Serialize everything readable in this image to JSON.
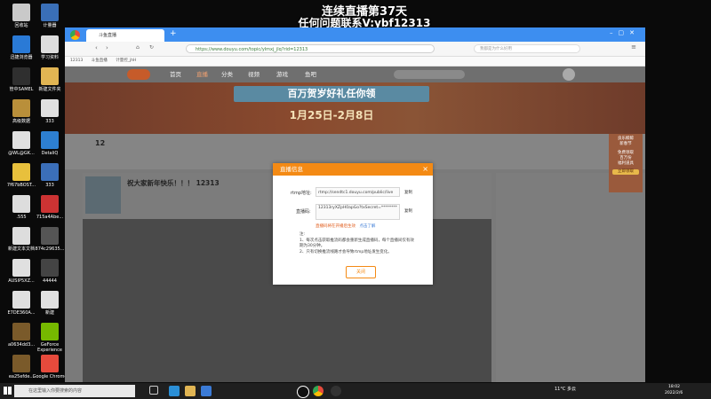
{
  "overlay": {
    "line1": "连续直播第37天",
    "line2": "任何问题联系V:ybf12313"
  },
  "desktop_icons": [
    {
      "label": "回收站",
      "color": "#c9c9c9"
    },
    {
      "label": "计量器",
      "color": "#3a6fb7"
    },
    {
      "label": "迅捷浏览器",
      "color": "#2a7ad6"
    },
    {
      "label": "学习资料",
      "color": "#dddddd"
    },
    {
      "label": "管中SAMEL",
      "color": "#2f2f2f"
    },
    {
      "label": "新建文件夹",
      "color": "#e1b553"
    },
    {
      "label": "高级数据",
      "color": "#b98f3a"
    },
    {
      "label": "333",
      "color": "#e0e0e0"
    },
    {
      "label": "@WL@GK...",
      "color": "#e0e0e0"
    },
    {
      "label": "DetaliQ",
      "color": "#2d7fd1"
    },
    {
      "label": "7f67bBOST...",
      "color": "#e8c03c"
    },
    {
      "label": "333",
      "color": "#3b6fb9"
    },
    {
      "label": ".555",
      "color": "#dddddd"
    },
    {
      "label": "715a4Abe...",
      "color": "#c33"
    },
    {
      "label": "新建文本文档",
      "color": "#dddddd"
    },
    {
      "label": "874c29635...",
      "color": "#555"
    },
    {
      "label": "AUSIP5XZ...",
      "color": "#e0e0e0"
    },
    {
      "label": "44444",
      "color": "#444"
    },
    {
      "label": "E7DE360A...",
      "color": "#e0e0e0"
    },
    {
      "label": "新建",
      "color": "#e0e0e0"
    },
    {
      "label": "a0634dd3...",
      "color": "#7a5a2a"
    },
    {
      "label": "GeForce Experience",
      "color": "#76b900"
    },
    {
      "label": "ea25efde...",
      "color": "#7a5a2a"
    },
    {
      "label": "Google Chrome",
      "color": "#e64a3c"
    }
  ],
  "browser": {
    "tab_title": "斗鱼直播",
    "url": "https://www.douyu.com/topic/ylmxj_jlq?rid=12313",
    "bookmarks": [
      "12313",
      "斗鱼直播",
      "计量控_jhH"
    ],
    "search_placeholder": "我都是为什么好用"
  },
  "site": {
    "nav": [
      "首页",
      "直播",
      "分类",
      "视频",
      "游戏",
      "鱼吧"
    ],
    "banner_title": "百万贺岁好礼任你领",
    "banner_date": "1月25日-2月8日",
    "room_title": "祝大家新年快乐！！！ 12313",
    "room_count": "12",
    "banner_right_top": "良乐鲸鲸\n新春节",
    "banner_right_gift": "免费领取\n百万份\n福利道具",
    "banner_right_btn": "立即领取"
  },
  "modal": {
    "title": "直播信息",
    "close": "×",
    "rtmp_label": "rtmp地址:",
    "rtmp_value": "rtmp://sendtc1.douyu.com/public/live",
    "key_label": "直播码:",
    "key_value": "12313ryXZpH0apGo?txSecret=********",
    "copy": "复制",
    "warning": "直播码将在开播后生效",
    "learn_more": "点击了解",
    "note_title": "注:",
    "notes": [
      "1、每次点击获取推流码都会重新生成直播码，每个直播间仅有效期为30分钟。",
      "2、只有切换推流线路才会导致rtmp地址发生变化。"
    ],
    "ok": "关闭"
  },
  "taskbar": {
    "search_placeholder": "在这里输入你要搜索的内容",
    "weather": "11°C 多云",
    "time": "18:02",
    "date": "2022/2/6"
  }
}
